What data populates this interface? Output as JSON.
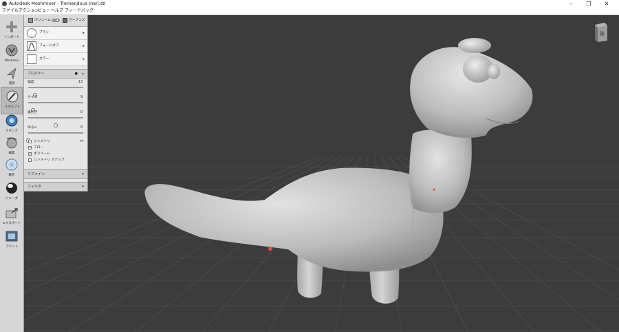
{
  "window": {
    "title": "Autodesk Meshmixer - Tremendous Inari.stl",
    "controls": [
      "minimize",
      "restore",
      "close"
    ]
  },
  "menu": [
    "ファイル",
    "アクション",
    "ビュー",
    "ヘルプ",
    "フィードバック"
  ],
  "tools": [
    {
      "label": "インポート",
      "icon": "plus-icon",
      "active": false
    },
    {
      "label": "Meshmix",
      "icon": "meshmix-icon",
      "active": false
    },
    {
      "label": "選択",
      "icon": "select-arrow-icon",
      "active": false
    },
    {
      "label": "スカルプト",
      "icon": "brush-icon",
      "active": true
    },
    {
      "label": "スタンプ",
      "icon": "stamp-icon",
      "active": false
    },
    {
      "label": "編集",
      "icon": "edit-icon",
      "active": false
    },
    {
      "label": "解析",
      "icon": "analysis-icon",
      "active": false
    },
    {
      "label": "シェーダ",
      "icon": "shader-sphere-icon",
      "active": false
    },
    {
      "label": "エクスポート",
      "icon": "export-icon",
      "active": false
    },
    {
      "label": "プリント",
      "icon": "print-icon",
      "active": false
    }
  ],
  "panel": {
    "modes": {
      "volume": "ボリューム",
      "surface": "サーフェス"
    },
    "brushes": [
      {
        "label": "ブラシ",
        "icon": "brush-circle-icon"
      },
      {
        "label": "フォールオフ",
        "icon": "falloff-curve-icon"
      },
      {
        "label": "カラー",
        "icon": "color-swatch-icon"
      }
    ],
    "properties": {
      "title": "プロパティ",
      "sliders": [
        {
          "label": "強度",
          "value": "13",
          "fraction": 0.13
        },
        {
          "label": "サイズ",
          "value": "9",
          "fraction": 0.09
        },
        {
          "label": "奥行き",
          "value": "0",
          "fraction": 0.5
        },
        {
          "label": "ゆるい",
          "value": "0",
          "fraction": 0.0
        }
      ],
      "checkboxes": [
        {
          "label": "シンメトリ",
          "checked": false
        },
        {
          "label": "フロー",
          "checked": true
        },
        {
          "label": "ボリューム",
          "checked": true
        },
        {
          "label": "シンメトリ スナップ",
          "checked": false
        }
      ]
    },
    "refine": "リファイン",
    "filter": "フィルタ"
  },
  "viewcube": {
    "face": "後"
  },
  "colors": {
    "viewport": "#3c3c3c",
    "grid": "#555555",
    "mesh": "#bdbdbd",
    "panel": "#e6e6e6",
    "marker": "#e84a3a"
  }
}
